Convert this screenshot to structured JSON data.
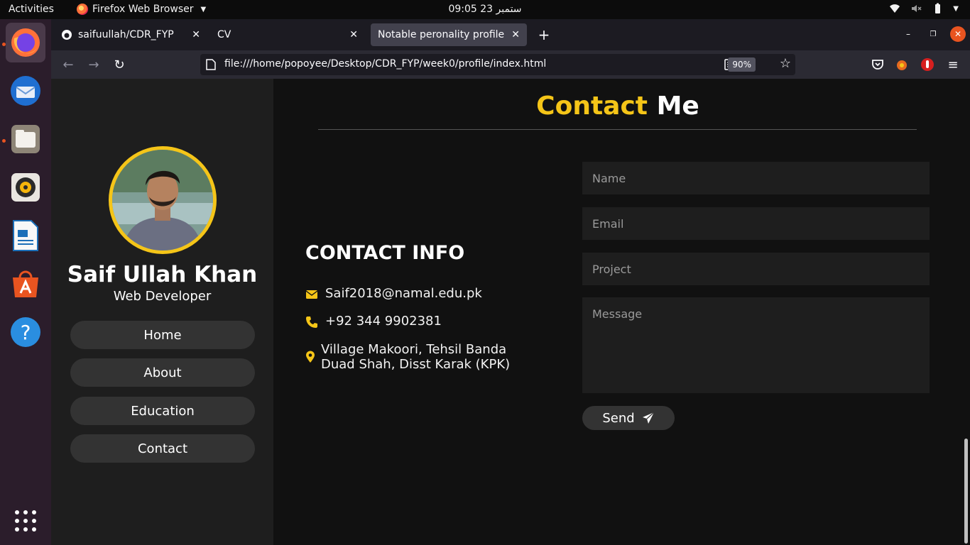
{
  "system": {
    "activities": "Activities",
    "app_name": "Firefox Web Browser",
    "clock": "09:05  ستمبر 23"
  },
  "browser": {
    "tabs": [
      {
        "label": "saifuullah/CDR_FYP"
      },
      {
        "label": "CV"
      },
      {
        "label": "Notable peronality profile p"
      }
    ],
    "url": "file:///home/popoyee/Desktop/CDR_FYP/week0/profile/index.html",
    "zoom": "90%"
  },
  "sidebar": {
    "name": "Saif Ullah Khan",
    "role": "Web Developer",
    "nav": [
      {
        "label": "Home"
      },
      {
        "label": "About"
      },
      {
        "label": "Education"
      },
      {
        "label": "Contact"
      }
    ]
  },
  "contact": {
    "title_accent": "Contact",
    "title_rest": "Me",
    "info_heading": "CONTACT INFO",
    "email": "Saif2018@namal.edu.pk",
    "phone": "+92 344 9902381",
    "address_line1": "Village Makoori, Tehsil Banda",
    "address_line2": "Duad Shah, Disst Karak (KPK)",
    "form": {
      "name_placeholder": "Name",
      "email_placeholder": "Email",
      "project_placeholder": "Project",
      "message_placeholder": "Message",
      "send_label": "Send"
    }
  },
  "colors": {
    "accent": "#f5c518",
    "page_bg": "#111111",
    "sidebar_bg": "#1e1e1e",
    "button_bg": "#333333"
  }
}
